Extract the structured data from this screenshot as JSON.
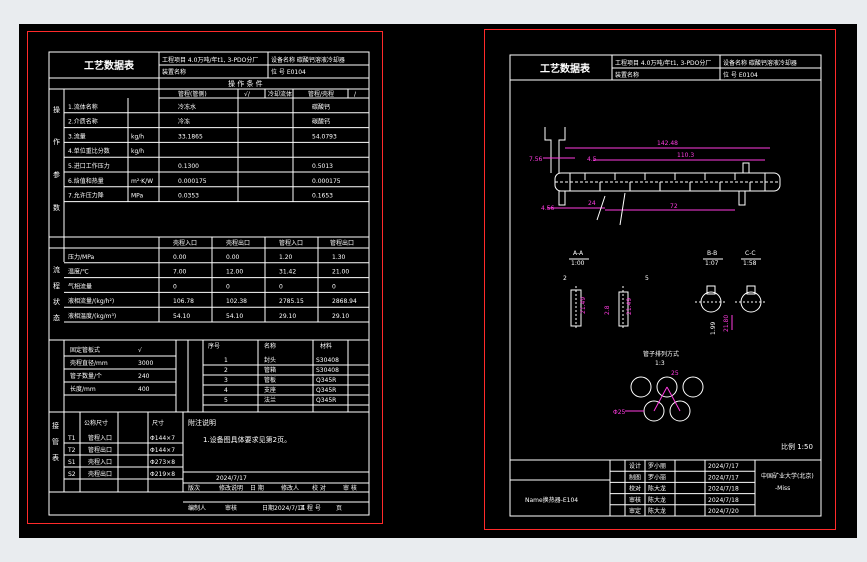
{
  "left_sheet": {
    "title": "工艺数据表",
    "project": "工程项目 4.0万吨/年t1, 3-PDO分厂",
    "unit": "装置名称",
    "equipment": "设备名称 碳酸钙溶液冷却器",
    "tag": "位  号  E0104",
    "conditions_header": "操 作 条 件",
    "col_shell": "管程(管侧)",
    "col_check": "√/",
    "col_check2": "/",
    "col_tube": "壳程(壳侧)",
    "col_fluid_shell": "冷却流体",
    "col_fluid_tube": "管程/壳程",
    "rows": [
      {
        "label": "1.流体名称",
        "shell": "冷冻水",
        "tube": "碳酸钙"
      },
      {
        "label": "2.介质名称",
        "shell": "冷冻",
        "tube": "碳酸钙"
      },
      {
        "label": "3.流量",
        "unit": "kg/h",
        "shell": "33.1865",
        "tube": "54.0793"
      },
      {
        "label": "4.单位重比分数",
        "unit": "kg/h",
        "shell": "",
        "tube": ""
      },
      {
        "label": "5.进口工作压力",
        "unit": "",
        "shell": "0.1300",
        "tube": "0.5013"
      },
      {
        "label": "6.焓值和热量",
        "unit": "m²·K/W",
        "shell": "0.000175",
        "tube": "0.000175"
      },
      {
        "label": "7.允许压力降",
        "unit": "MPa",
        "shell": "0.0353",
        "tube": "0.1653"
      }
    ],
    "side_labels": [
      "操",
      "作",
      "参",
      "数"
    ],
    "mid_header": [
      "壳程入口",
      "壳程出口",
      "管程入口",
      "管程出口"
    ],
    "mid_rows": [
      {
        "label": "压力/MPa",
        "values": [
          "0.00",
          "0.00",
          "1.20",
          "1.30"
        ]
      },
      {
        "label": "温度/℃",
        "values": [
          "7.00",
          "12.00",
          "31.42",
          "21.00"
        ]
      },
      {
        "label": "气相流量",
        "values": [
          "0",
          "0",
          "0",
          "0"
        ]
      },
      {
        "label": "液相流量/(kg/h²)",
        "values": [
          "106.78",
          "102.38",
          "2785.15",
          "2868.94"
        ]
      },
      {
        "label": "液相温度/(kg/m³)",
        "values": [
          "54.10",
          "54.10",
          "29.10",
          "29.10"
        ]
      }
    ],
    "mid_side": [
      "流",
      "程",
      "状",
      "态"
    ],
    "design_rows": [
      {
        "label": "固定管板式",
        "value": "√"
      },
      {
        "label": "壳程直径/mm",
        "value": "3000"
      },
      {
        "label": "管子数量/个",
        "value": "240"
      },
      {
        "label": "长度/mm",
        "value": "400"
      }
    ],
    "parts_header": [
      "序号",
      "名称",
      "材料"
    ],
    "parts": [
      {
        "n": "1",
        "name": "封头",
        "mat": "S30408"
      },
      {
        "n": "2",
        "name": "管箱",
        "mat": "S30408"
      },
      {
        "n": "3",
        "name": "管板",
        "mat": "Q345R"
      },
      {
        "n": "4",
        "name": "支座",
        "mat": "Q345R"
      },
      {
        "n": "5",
        "name": "法兰",
        "mat": "Q345R"
      }
    ],
    "nozzle_header": [
      "接管",
      "公称尺寸",
      "用途",
      "尺寸"
    ],
    "nozzles": [
      {
        "id": "T1",
        "desc": "管程入口",
        "size": "Φ144×7"
      },
      {
        "id": "T2",
        "desc": "管程出口",
        "size": "Φ144×7"
      },
      {
        "id": "S1",
        "desc": "壳程入口",
        "size": "Φ273×8"
      },
      {
        "id": "S2",
        "desc": "壳程出口",
        "size": "Φ219×8"
      }
    ],
    "nozzle_side": [
      "接",
      "管",
      "表"
    ],
    "notes_title": "附注说明",
    "notes": "1.设备图具体要求见第2页。",
    "rev_date": "2024/7/17",
    "rev_row": [
      "版次",
      "修改说明",
      "日 期",
      "修改人",
      "校 对",
      "审 核"
    ],
    "bottom_row": [
      "编制人",
      "审核",
      "日期2024/7/14",
      "工 程 号",
      "页"
    ]
  },
  "right_sheet": {
    "title": "工艺数据表",
    "project": "工程项目 4.0万吨/年t1, 3-PDO分厂",
    "unit": "装置名称",
    "equipment": "设备名称 碳酸钙溶液冷却器",
    "tag": "位  号  E0104",
    "dims": {
      "overall": "142.48",
      "inner": "110.3",
      "left_a": "7.56",
      "left_b": "4.5",
      "bot_a": "4.56",
      "bot_b": "24",
      "bot_c": "72"
    },
    "sec_a": "A-A",
    "sec_a_scale": "1:00",
    "sec_b": "B-B",
    "sec_b_scale": "1:07",
    "sec_c": "C-C",
    "sec_c_scale": "1:58",
    "sec_dims": [
      "2",
      "21.49",
      "2.8",
      "21.49",
      "5",
      "3",
      "21.80",
      "1.99"
    ],
    "tube_layout": "管子排列方式",
    "tube_scale": "1:3",
    "pitch": "25",
    "diameter": "Φ25",
    "ratio": "比例 1:50",
    "tb_rows": [
      {
        "role": "设计",
        "name": "罗小丽",
        "date": "2024/7/17"
      },
      {
        "role": "制图",
        "name": "罗小丽",
        "date": "2024/7/17"
      },
      {
        "role": "校对",
        "name": "陈大龙",
        "date": "2024/7/18"
      },
      {
        "role": "审核",
        "name": "陈大龙",
        "date": "2024/7/18"
      },
      {
        "role": "审定",
        "name": "陈大龙",
        "date": "2024/7/20"
      }
    ],
    "school": "中国矿业大学(北京)",
    "school_sub": "-Miss",
    "drawing_name": "Name换热器-E104"
  }
}
